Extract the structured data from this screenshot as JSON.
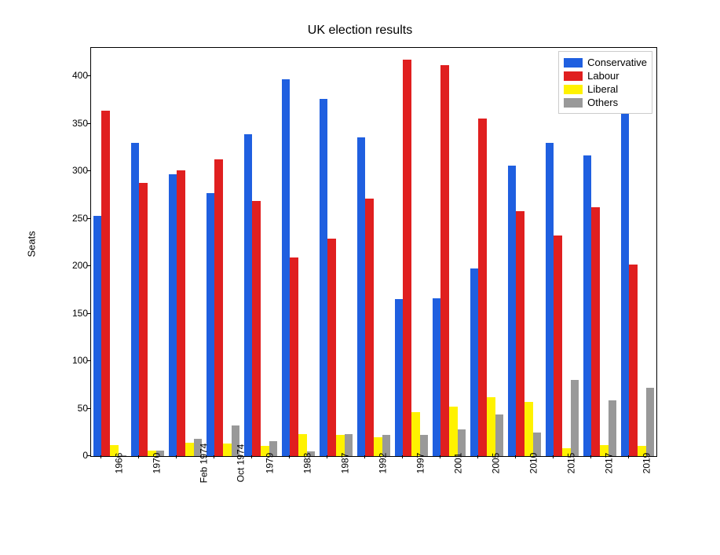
{
  "chart_data": {
    "type": "bar",
    "title": "UK election results",
    "ylabel": "Seats",
    "xlabel": "",
    "ylim": [
      0,
      430
    ],
    "yticks": [
      0,
      50,
      100,
      150,
      200,
      250,
      300,
      350,
      400
    ],
    "categories": [
      "1966",
      "1970",
      "Feb 1974",
      "Oct 1974",
      "1979",
      "1983",
      "1987",
      "1992",
      "1997",
      "2001",
      "2005",
      "2010",
      "2015",
      "2017",
      "2019"
    ],
    "series": [
      {
        "name": "Conservative",
        "color": "#1f5fe0",
        "values": [
          253,
          330,
          297,
          277,
          339,
          397,
          376,
          336,
          165,
          166,
          198,
          306,
          330,
          317,
          365
        ]
      },
      {
        "name": "Labour",
        "color": "#e01f1f",
        "values": [
          364,
          288,
          301,
          313,
          269,
          209,
          229,
          271,
          418,
          412,
          356,
          258,
          232,
          262,
          202
        ]
      },
      {
        "name": "Liberal",
        "color": "#fff200",
        "values": [
          12,
          6,
          14,
          13,
          11,
          23,
          22,
          20,
          46,
          52,
          62,
          57,
          8,
          12,
          11
        ]
      },
      {
        "name": "Others",
        "color": "#999999",
        "values": [
          1,
          6,
          18,
          32,
          16,
          5,
          23,
          22,
          22,
          28,
          44,
          25,
          80,
          59,
          72
        ]
      }
    ]
  }
}
